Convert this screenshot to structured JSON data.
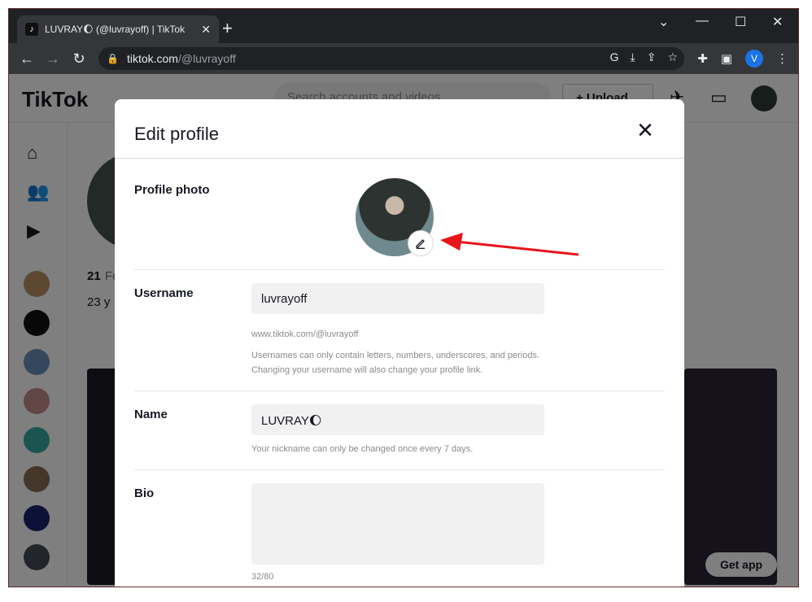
{
  "browser": {
    "tab_title": "LUVRAY🌔 (@luvrayoff) | TikTok",
    "tab_close": "✕",
    "new_tab": "+",
    "url_host": "tiktok.com",
    "url_path": "/@luvrayoff",
    "profile_initial": "V"
  },
  "background_page": {
    "logo": "TikTok",
    "search_placeholder": "Search accounts and videos",
    "upload_label": "+ Upload",
    "following_count": "21",
    "following_label": "Fo",
    "bio_partial": "23 y",
    "get_app": "Get app"
  },
  "modal": {
    "title": "Edit profile",
    "close": "✕",
    "profile_photo_label": "Profile photo",
    "username_label": "Username",
    "username_value": "luvrayoff",
    "username_url": "www.tiktok.com/@luvrayoff",
    "username_hint": "Usernames can only contain letters, numbers, underscores, and periods. Changing your username will also change your profile link.",
    "name_label": "Name",
    "name_value": "LUVRAY🌔",
    "name_hint": "Your nickname can only be changed once every 7 days.",
    "bio_label": "Bio",
    "bio_value": "",
    "bio_counter": "32/80"
  },
  "colors": {
    "annotation_arrow": "#e8141c",
    "chrome_dark": "#202124",
    "chrome_toolbar": "#35363a"
  }
}
